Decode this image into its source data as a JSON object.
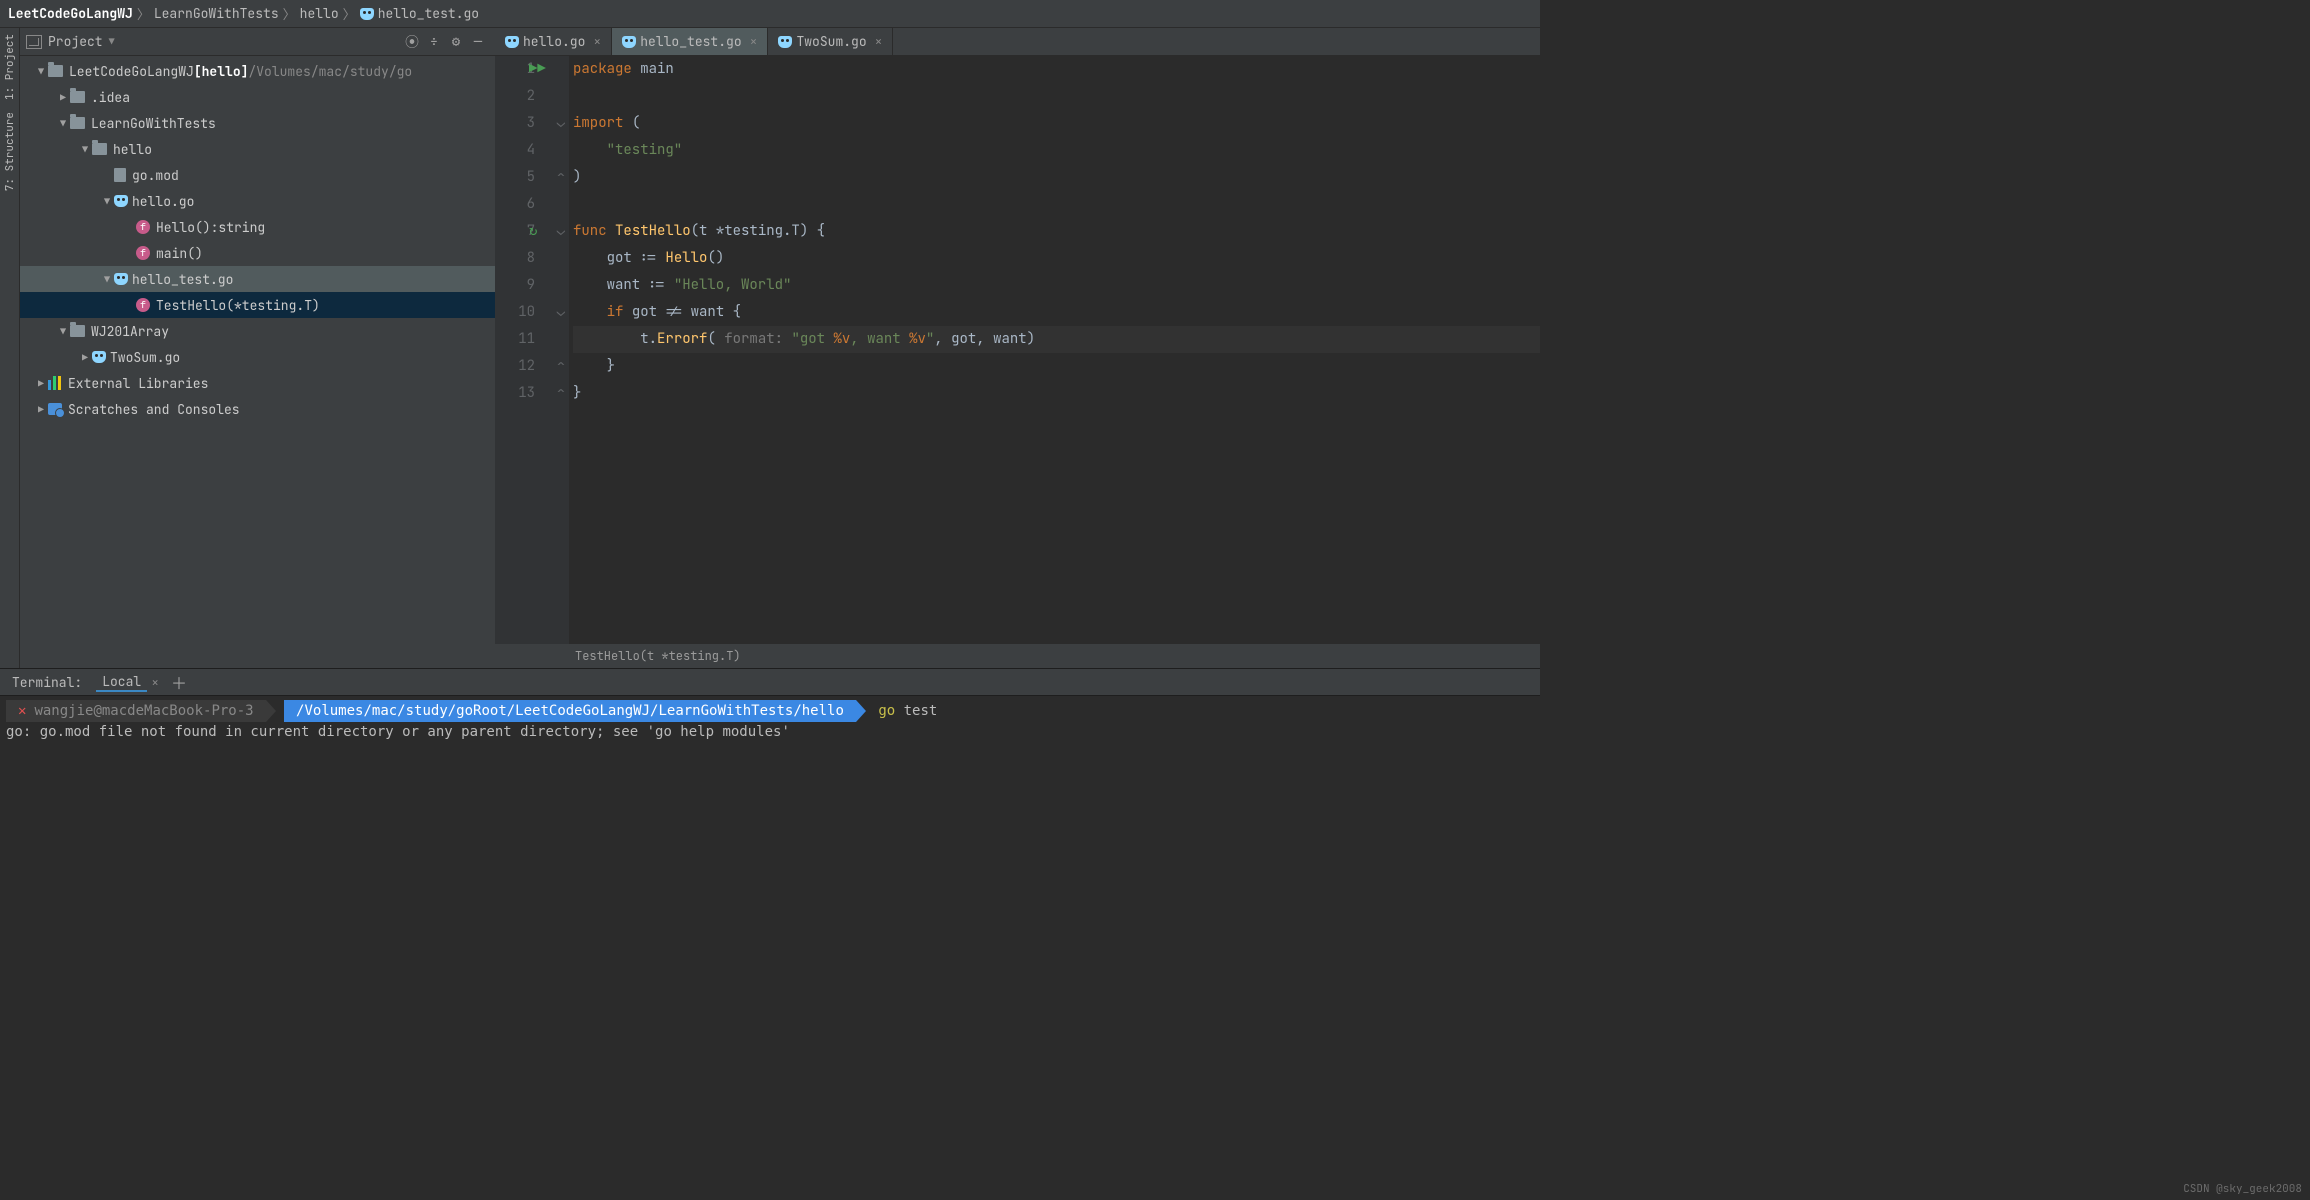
{
  "breadcrumb": [
    "LeetCodeGoLangWJ",
    "LearnGoWithTests",
    "hello",
    "hello_test.go"
  ],
  "left_tools": {
    "project": "1: Project",
    "structure": "7: Structure"
  },
  "project_panel": {
    "title": "Project",
    "icons": {
      "target": "⦿",
      "sep": "÷",
      "gear": "⚙",
      "min": "—"
    },
    "tree": [
      {
        "d": 0,
        "arrow": "▼",
        "icon": "folder",
        "label": "LeetCodeGoLangWJ",
        "bold": "[hello]",
        "dim": " /Volumes/mac/study/go"
      },
      {
        "d": 1,
        "arrow": "▶",
        "icon": "folder",
        "label": ".idea"
      },
      {
        "d": 1,
        "arrow": "▼",
        "icon": "folder",
        "label": "LearnGoWithTests"
      },
      {
        "d": 2,
        "arrow": "▼",
        "icon": "folder",
        "label": "hello"
      },
      {
        "d": 3,
        "arrow": "",
        "icon": "file",
        "label": "go.mod"
      },
      {
        "d": 3,
        "arrow": "▼",
        "icon": "go",
        "label": "hello.go"
      },
      {
        "d": 4,
        "arrow": "",
        "icon": "f",
        "label": "Hello():string"
      },
      {
        "d": 4,
        "arrow": "",
        "icon": "f",
        "label": "main()"
      },
      {
        "d": 3,
        "arrow": "▼",
        "icon": "go",
        "label": "hello_test.go",
        "sel": true
      },
      {
        "d": 4,
        "arrow": "",
        "icon": "f",
        "label": "TestHello(*testing.T)",
        "pick": true
      },
      {
        "d": 1,
        "arrow": "▼",
        "icon": "folder",
        "label": "WJ201Array"
      },
      {
        "d": 2,
        "arrow": "▶",
        "icon": "go",
        "label": "TwoSum.go"
      },
      {
        "d": 0,
        "arrow": "▶",
        "icon": "lib",
        "label": "External Libraries"
      },
      {
        "d": 0,
        "arrow": "▶",
        "icon": "scratch",
        "label": "Scratches and Consoles"
      }
    ]
  },
  "tabs": [
    {
      "name": "hello.go",
      "icon": "go",
      "active": false
    },
    {
      "name": "hello_test.go",
      "icon": "go",
      "active": true
    },
    {
      "name": "TwoSum.go",
      "icon": "go",
      "active": false
    }
  ],
  "code": {
    "lines": [
      {
        "n": 1,
        "run": "▶▶",
        "html": "<span class='k'>package</span> <span class='n'>main</span>"
      },
      {
        "n": 2,
        "html": ""
      },
      {
        "n": 3,
        "mark": "⌄",
        "html": "<span class='k'>import</span> <span class='n'>(</span>"
      },
      {
        "n": 4,
        "html": "    <span class='s'>\"testing\"</span>"
      },
      {
        "n": 5,
        "mark": "⌃",
        "html": "<span class='n'>)</span>"
      },
      {
        "n": 6,
        "html": ""
      },
      {
        "n": 7,
        "run": "↻",
        "mark": "⌄",
        "html": "<span class='k'>func</span> <span class='fn'>TestHello</span><span class='n'>(t *testing.T) {</span>"
      },
      {
        "n": 8,
        "html": "    <span class='n'>got := </span><span class='fn'>Hello</span><span class='n'>()</span>"
      },
      {
        "n": 9,
        "html": "    <span class='n'>want := </span><span class='s'>\"Hello, World\"</span>"
      },
      {
        "n": 10,
        "mark": "⌄",
        "html": "    <span class='k'>if</span> <span class='n'>got != want {</span>"
      },
      {
        "n": 11,
        "cur": true,
        "html": "        <span class='n'>t.</span><span class='fn'>Errorf</span><span class='n'>( </span><span class='hint'>format:</span> <span class='s'>\"got </span><span class='k'>%v</span><span class='s'>, want </span><span class='k'>%v</span><span class='s'>\"</span><span class='n'>, got, want)</span>"
      },
      {
        "n": 12,
        "mark": "⌃",
        "html": "    <span class='n'>}</span>"
      },
      {
        "n": 13,
        "mark": "⌃",
        "html": "<span class='n'>}</span>"
      }
    ],
    "crumb": "TestHello(t *testing.T)"
  },
  "terminal": {
    "label": "Terminal:",
    "tab": "Local",
    "host": "wangjie@macdeMacBook-Pro-3",
    "path": "/Volumes/mac/study/goRoot/LeetCodeGoLangWJ/LearnGoWithTests/hello",
    "cmd_y": "go",
    "cmd_rest": " test",
    "out": "go: go.mod file not found in current directory or any parent directory; see 'go help modules'"
  },
  "watermark": "CSDN @sky_geek2008"
}
